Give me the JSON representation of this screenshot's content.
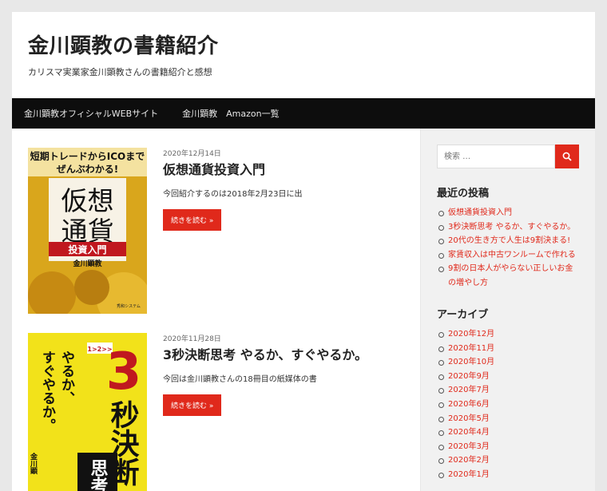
{
  "header": {
    "site_title": "金川顕教の書籍紹介",
    "site_description": "カリスマ実業家金川顕教さんの書籍紹介と感想"
  },
  "nav": {
    "items": [
      "金川顕教オフィシャルWEBサイト",
      "金川顕教　Amazon一覧"
    ]
  },
  "posts": [
    {
      "date": "2020年12月14日",
      "title": "仮想通貨投資入門",
      "excerpt": "今回紹介するのは2018年2月23日に出",
      "more_label": "続きを読む »",
      "cover": {
        "top_text_1": "短期トレードからICOまで",
        "top_text_2": "ぜんぶわかる!",
        "big_line_1": "仮想",
        "big_line_2": "通貨",
        "band_text": "投資入門",
        "author": "金川顕教",
        "publisher": "秀和システム"
      }
    },
    {
      "date": "2020年11月28日",
      "title": "3秒決断思考 やるか、すぐやるか。",
      "excerpt": "今回は金川顕教さんの18冊目の紙媒体の書",
      "more_label": "続きを読む »",
      "cover": {
        "vert_1": "やるか、",
        "vert_2": "すぐやるか。",
        "small_badge": "1>2>>",
        "big_3": "3",
        "big_kanji": "秒決断",
        "band_text": "思考",
        "author": "金川顕"
      }
    }
  ],
  "sidebar": {
    "search_placeholder": "検索 …",
    "recent_title": "最近の投稿",
    "recent_posts": [
      "仮想通貨投資入門",
      "3秒決断思考 やるか、すぐやるか。",
      "20代の生き方で人生は9割決まる!",
      "家賃収入は中古ワンルームで作れる",
      "9割の日本人がやらない正しいお金の増やし方"
    ],
    "archive_title": "アーカイブ",
    "archives": [
      "2020年12月",
      "2020年11月",
      "2020年10月",
      "2020年9月",
      "2020年7月",
      "2020年6月",
      "2020年5月",
      "2020年4月",
      "2020年3月",
      "2020年2月",
      "2020年1月"
    ]
  },
  "colors": {
    "accent": "#e0291b",
    "nav_bg": "#0d0d0d",
    "sidebar_bg": "#f1f1f1",
    "cover_yellow": "#f2e21a"
  }
}
